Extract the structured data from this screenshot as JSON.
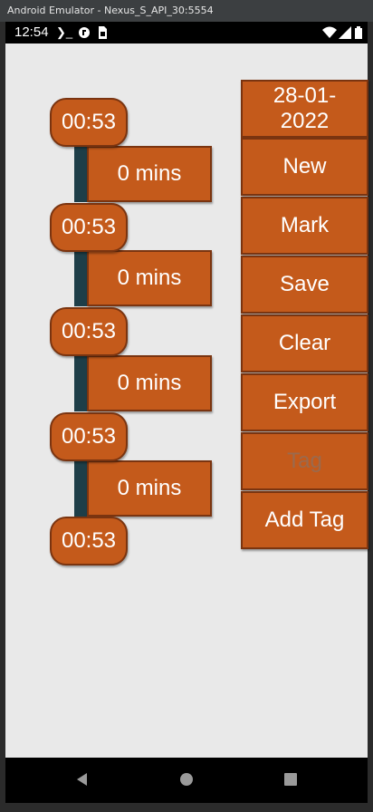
{
  "window": {
    "title": "Android Emulator - Nexus_S_API_30:5554"
  },
  "status_bar": {
    "time": "12:54",
    "icons": [
      "terminal-icon",
      "app-icon",
      "sim-icon",
      "wifi-icon",
      "signal-icon",
      "battery-icon"
    ]
  },
  "timeline": {
    "times": [
      "00:53",
      "00:53",
      "00:53",
      "00:53",
      "00:53"
    ],
    "durations": [
      "0 mins",
      "0 mins",
      "0 mins",
      "0 mins"
    ]
  },
  "actions": {
    "date": "28-01-2022",
    "new": "New",
    "mark": "Mark",
    "save": "Save",
    "clear": "Clear",
    "export": "Export",
    "tag": "Tag",
    "add_tag": "Add Tag"
  },
  "colors": {
    "button": "#c45a1b",
    "button_border": "#7a3410",
    "bar": "#1e3e48",
    "background": "#e9e9e9",
    "disabled_text": "#9a6a4e"
  },
  "navigation": {
    "icons": [
      "back-icon",
      "home-icon",
      "recents-icon"
    ]
  }
}
